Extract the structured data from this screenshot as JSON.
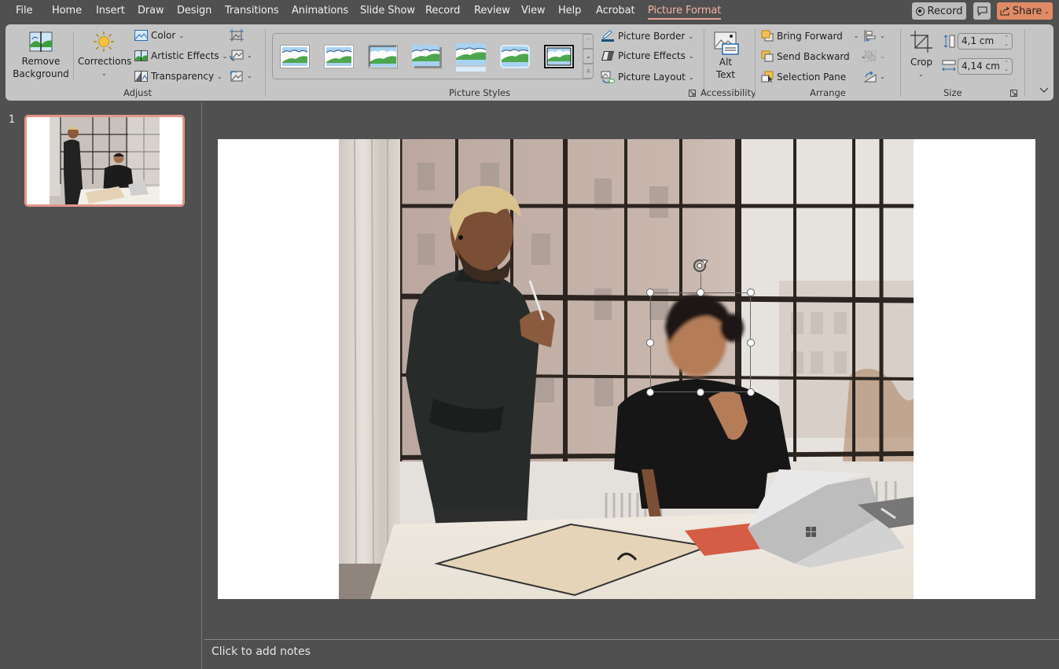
{
  "menubar": {
    "tabs": [
      "File",
      "Home",
      "Insert",
      "Draw",
      "Design",
      "Transitions",
      "Animations",
      "Slide Show",
      "Record",
      "Review",
      "View",
      "Help",
      "Acrobat",
      "Picture Format"
    ],
    "active_tab": "Picture Format",
    "record_button": "Record",
    "share_button": "Share",
    "accent_color": "#e3a292"
  },
  "ribbon": {
    "adjust": {
      "label": "Adjust",
      "remove_background_line1": "Remove",
      "remove_background_line2": "Background",
      "corrections": "Corrections",
      "color": "Color",
      "artistic_effects": "Artistic Effects",
      "transparency": "Transparency"
    },
    "picture_styles": {
      "label": "Picture Styles",
      "picture_border": "Picture Border",
      "picture_effects": "Picture Effects",
      "picture_layout": "Picture Layout"
    },
    "accessibility": {
      "label": "Accessibility",
      "alt_text_line1": "Alt",
      "alt_text_line2": "Text"
    },
    "arrange": {
      "label": "Arrange",
      "bring_forward": "Bring Forward",
      "send_backward": "Send Backward",
      "selection_pane": "Selection Pane"
    },
    "size": {
      "label": "Size",
      "crop": "Crop",
      "height": "4,1 cm",
      "width": "4,14 cm"
    }
  },
  "slides_pane": {
    "slide_number": "1"
  },
  "notes": {
    "placeholder": "Click to add notes"
  }
}
